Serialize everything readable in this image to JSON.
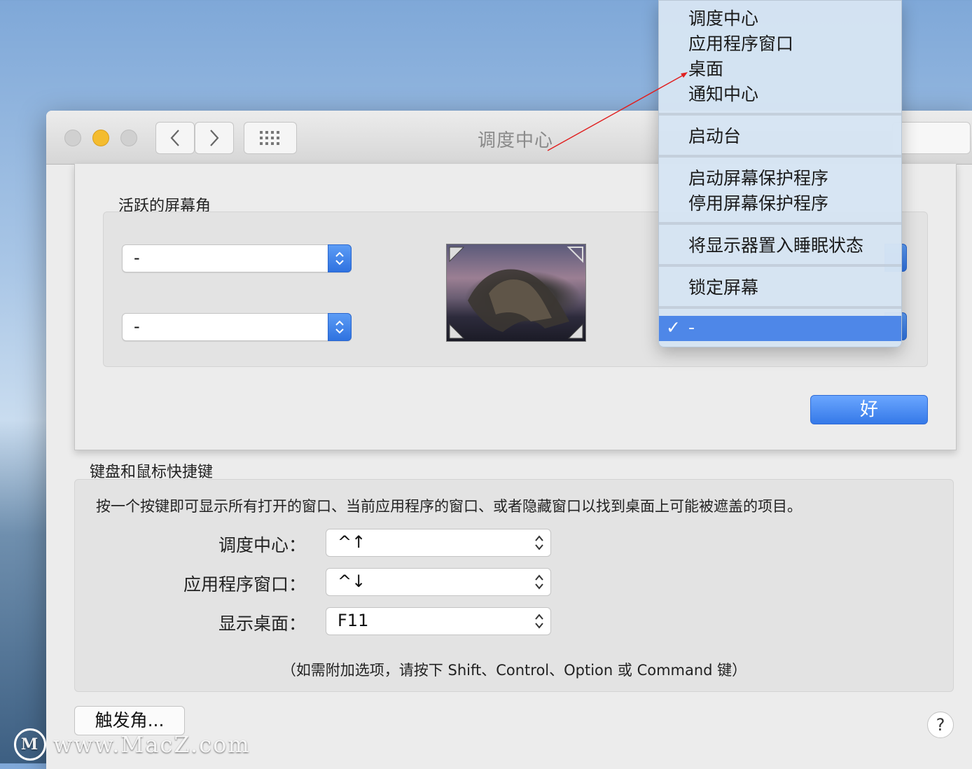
{
  "window": {
    "title": "调度中心"
  },
  "toolbar": {
    "back_icon": "chevron-left-icon",
    "forward_icon": "chevron-right-icon",
    "grid_icon": "grid-icon"
  },
  "hot_corners": {
    "section_label": "活跃的屏幕角",
    "top_left_value": "-",
    "bottom_left_value": "-",
    "ok_label": "好"
  },
  "corner_menu": {
    "items": [
      "调度中心",
      "应用程序窗口",
      "桌面",
      "通知中心",
      "启动台",
      "启动屏幕保护程序",
      "停用屏幕保护程序",
      "将显示器置入睡眠状态",
      "锁定屏幕"
    ],
    "selected_check": "✓",
    "selected_label": "-"
  },
  "shortcuts": {
    "section_label": "键盘和鼠标快捷键",
    "description": "按一个按键即可显示所有打开的窗口、当前应用程序的窗口、或者隐藏窗口以找到桌面上可能被遮盖的项目。",
    "rows": [
      {
        "label": "调度中心：",
        "value": "^↑"
      },
      {
        "label": "应用程序窗口：",
        "value": "^↓"
      },
      {
        "label": "显示桌面：",
        "value": "F11"
      }
    ],
    "hint": "（如需附加选项，请按下 Shift、Control、Option 或 Command 键）"
  },
  "footer": {
    "hot_corners_button": "触发角...",
    "help": "?"
  },
  "watermark": {
    "logo": "M",
    "text": "www.MacZ.com"
  },
  "colors": {
    "accent": "#3579e8",
    "menu_selected": "#4e87e8",
    "annotation_arrow": "#e02020"
  }
}
